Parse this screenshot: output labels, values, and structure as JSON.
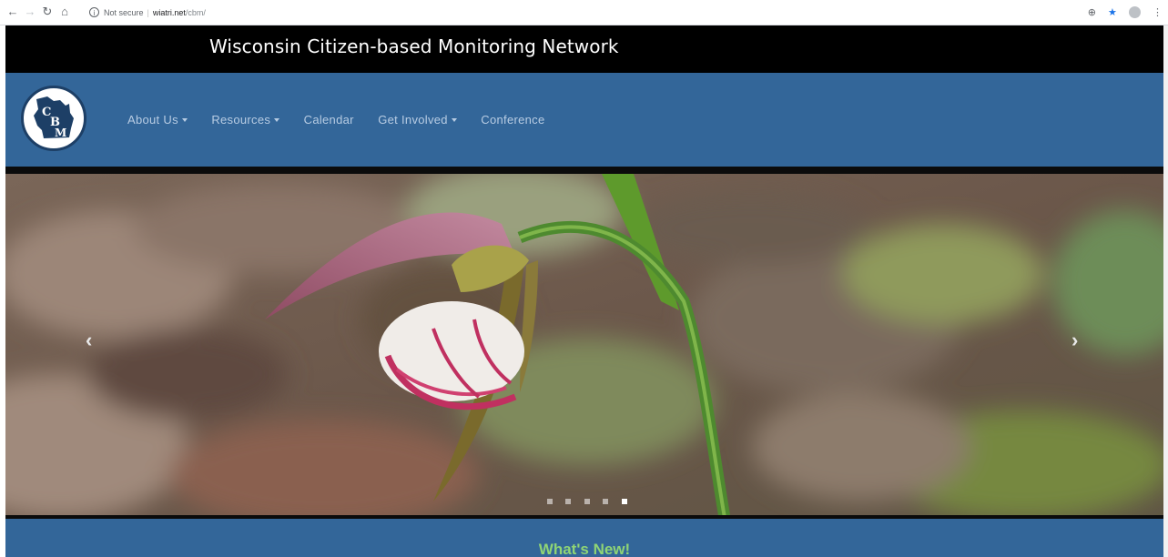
{
  "browser": {
    "security": "Not secure",
    "url_host": "wiatri.net",
    "url_path": "/cbm/",
    "icons": [
      "back-icon",
      "forward-icon",
      "reload-icon",
      "home-icon",
      "info-icon",
      "zoom-icon",
      "star-icon",
      "profile-icon",
      "menu-icon"
    ]
  },
  "site": {
    "title": "Wisconsin Citizen-based Monitoring Network",
    "logo_text": [
      "C",
      "B",
      "M"
    ],
    "nav": [
      {
        "label": "About Us",
        "dropdown": true
      },
      {
        "label": "Resources",
        "dropdown": true
      },
      {
        "label": "Calendar",
        "dropdown": false
      },
      {
        "label": "Get Involved",
        "dropdown": true
      },
      {
        "label": "Conference",
        "dropdown": false
      }
    ]
  },
  "carousel": {
    "prev_label": "‹",
    "next_label": "›",
    "slide_count": 5,
    "active_slide": 5
  },
  "news": {
    "heading": "What's New!"
  },
  "colors": {
    "title_bar": "#000000",
    "navbar": "#336699",
    "nav_text": "#b8cce3",
    "news_heading": "#8fd475"
  }
}
